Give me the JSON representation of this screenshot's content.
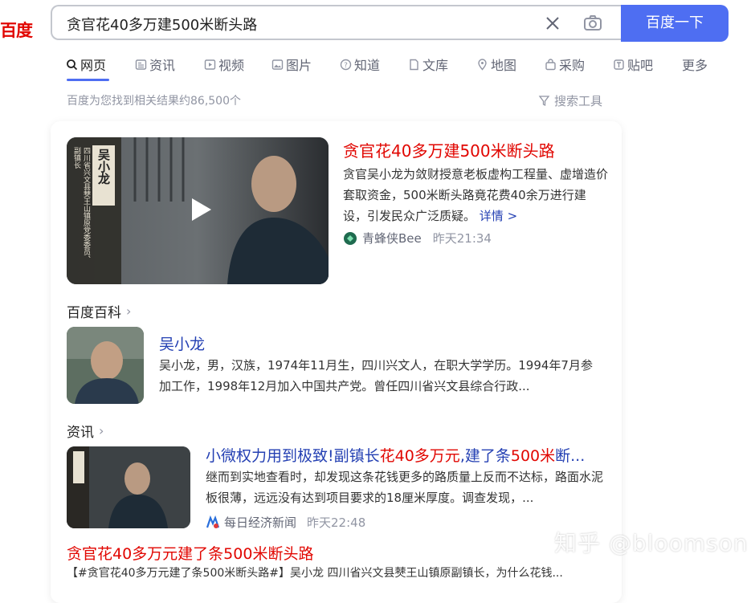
{
  "logo": {
    "text": "百度"
  },
  "search": {
    "query": "贪官花40多万建500米断头路",
    "button_label": "百度一下"
  },
  "tabs": [
    {
      "label": "网页",
      "icon": "search-icon",
      "active": true
    },
    {
      "label": "资讯",
      "icon": "news-icon"
    },
    {
      "label": "视频",
      "icon": "video-icon"
    },
    {
      "label": "图片",
      "icon": "image-icon"
    },
    {
      "label": "知道",
      "icon": "question-icon"
    },
    {
      "label": "文库",
      "icon": "doc-icon"
    },
    {
      "label": "地图",
      "icon": "map-icon"
    },
    {
      "label": "采购",
      "icon": "bag-icon"
    },
    {
      "label": "贴吧",
      "icon": "tieba-icon"
    },
    {
      "label": "更多"
    }
  ],
  "result_count": "百度为您找到相关结果约86,500个",
  "search_tools": "搜索工具",
  "top_result": {
    "thumb_caption_name": "吴小龙",
    "thumb_caption_role": "四川省兴文县僰王山镇原党委委员、副镇长",
    "title": "贪官花40多万建500米断头路",
    "description": "贪官吴小龙为敛财授意老板虚构工程量、虚增造价套取资金，500米断头路竟花费40余万进行建设，引发民众广泛质疑。",
    "more_link": "详情 >",
    "source_name": "青蜂侠Bee",
    "source_time": "昨天21:34"
  },
  "baike": {
    "section_label": "百度百科",
    "name": "吴小龙",
    "description": "吴小龙，男，汉族，1974年11月生，四川兴文人，在职大学学历。1994年7月参加工作，1998年12月加入中国共产党。曾任四川省兴文县综合行政..."
  },
  "news": {
    "section_label": "资讯",
    "title_parts": [
      "小微权力用到极致!副镇长",
      "花40多万元",
      ",建了条",
      "500米",
      "断..."
    ],
    "description": "继而到实地查看时，却发现这条花钱更多的路质量上反而不达标，路面水泥板很薄，远远没有达到项目要求的18厘米厚度。调查发现，...",
    "source_name": "每日经济新闻",
    "source_time": "昨天22:48"
  },
  "result2": {
    "title": "贪官花40多万元建了条500米断头路",
    "snippet": "【#贪官花40多万元建了条500米断头路#】吴小龙 四川省兴文县僰王山镇原副镇长，为什么花钱..."
  },
  "watermark": "知乎 @bloomson",
  "colors": {
    "accent": "#4e6ef2",
    "title_red": "#e10601",
    "link_blue": "#2440b3"
  }
}
